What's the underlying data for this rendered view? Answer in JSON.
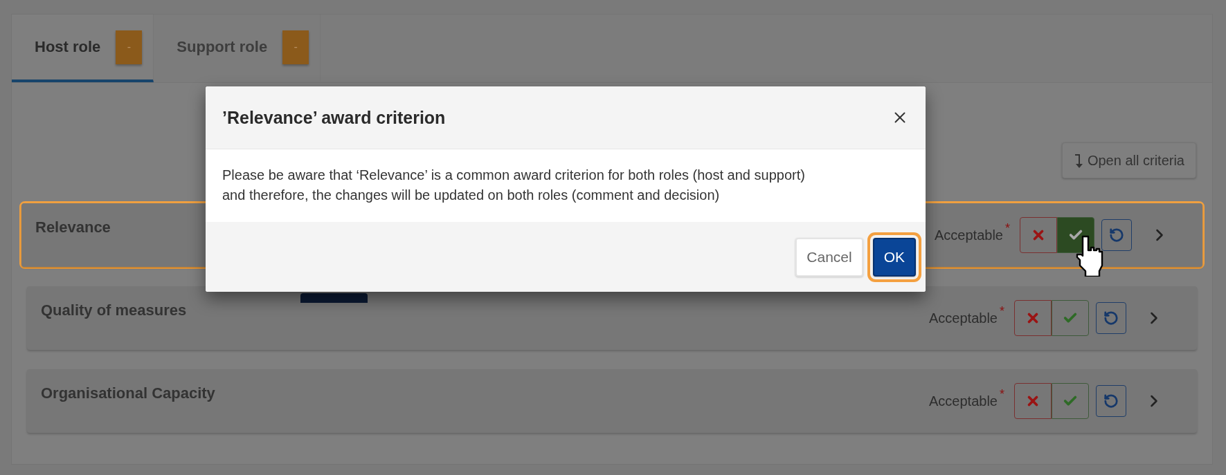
{
  "tabs": [
    {
      "label": "Host role",
      "badge": "-",
      "selected": true
    },
    {
      "label": "Support role",
      "badge": "-",
      "selected": false
    }
  ],
  "open_all_button": {
    "label": "Open all criteria"
  },
  "criteria": [
    {
      "title": "Relevance",
      "status": "Acceptable",
      "required_mark": "*",
      "accepted": true,
      "focused": true
    },
    {
      "title": "Quality of measures",
      "status": "Acceptable",
      "required_mark": "*",
      "accepted": false,
      "focused": false
    },
    {
      "title": "Organisational Capacity",
      "status": "Acceptable",
      "required_mark": "*",
      "accepted": false,
      "focused": false
    }
  ],
  "dialog": {
    "title": "’Relevance’ award criterion",
    "message": "Please be aware that ‘Relevance’ is a common award criterion for both roles (host and support) and therefore, the changes will be updated on both roles (comment and decision)",
    "buttons": [
      {
        "label": "Cancel",
        "kind": "secondary",
        "focused": false
      },
      {
        "label": "OK",
        "kind": "primary",
        "focused": true
      }
    ]
  }
}
